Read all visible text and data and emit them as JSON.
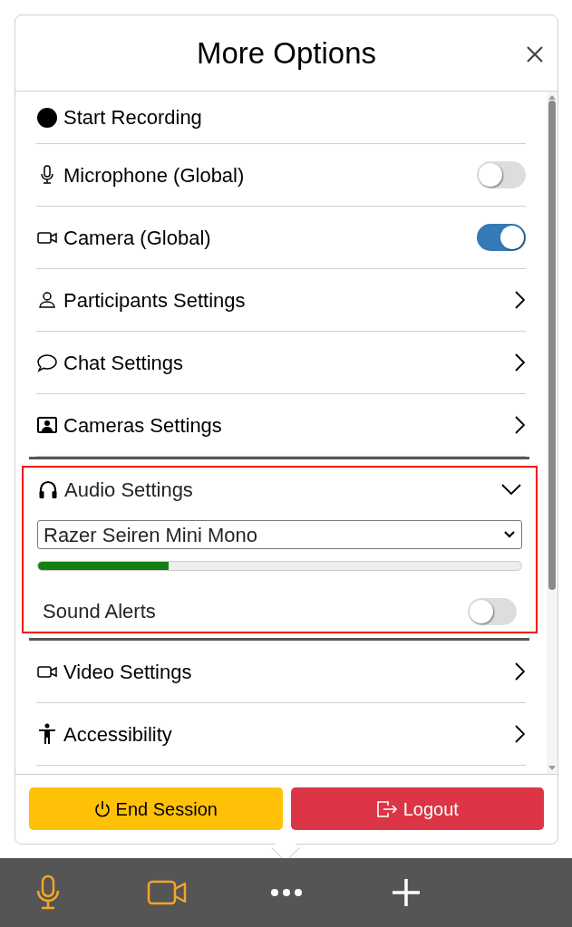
{
  "dialog": {
    "title": "More Options"
  },
  "items": [
    {
      "kind": "action",
      "label": "Start Recording"
    },
    {
      "kind": "toggle",
      "label": "Microphone (Global)",
      "on": false
    },
    {
      "kind": "toggle",
      "label": "Camera (Global)",
      "on": true
    },
    {
      "kind": "link",
      "label": "Participants Settings"
    },
    {
      "kind": "link",
      "label": "Chat Settings"
    },
    {
      "kind": "link",
      "label": "Cameras Settings"
    },
    {
      "kind": "section",
      "label": "Audio Settings",
      "expanded": true,
      "highlighted": true,
      "device": "Razer Seiren Mini Mono",
      "level": 0.27,
      "sound_alerts": {
        "label": "Sound Alerts",
        "on": false
      }
    },
    {
      "kind": "link",
      "label": "Video Settings"
    },
    {
      "kind": "link",
      "label": "Accessibility"
    }
  ],
  "footer": [
    {
      "kind": "warning",
      "label": "End Session"
    },
    {
      "kind": "danger",
      "label": "Logout"
    }
  ]
}
